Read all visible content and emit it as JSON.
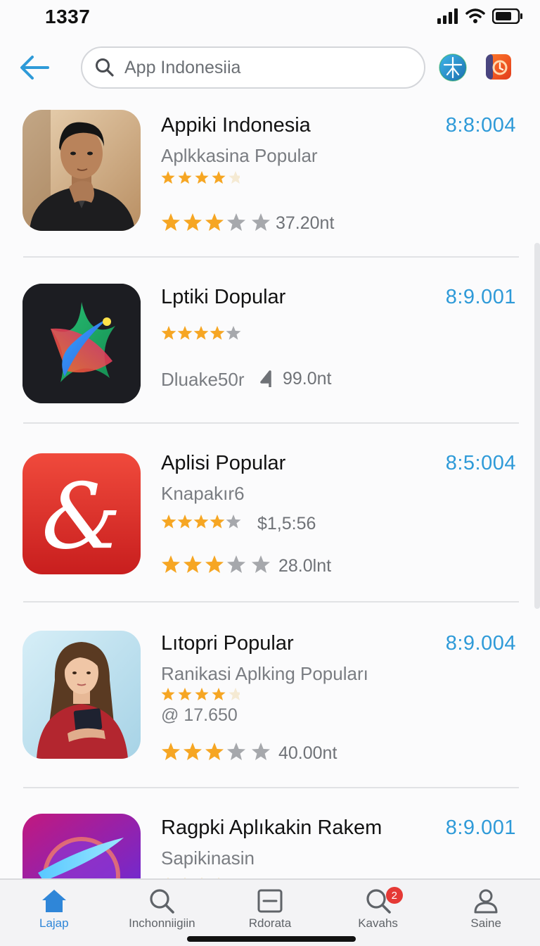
{
  "status_bar": {
    "time": "1337"
  },
  "header": {
    "search_placeholder": "App Indonesiia",
    "icons": [
      "back-arrow-icon",
      "search-icon",
      "globe-app-icon",
      "orange-app-icon"
    ]
  },
  "apps": [
    {
      "name": "Appiki Indonesia",
      "version": "8:8:004",
      "subtitle": "Aplkkasina Popular",
      "rating_text": "37.20nt",
      "thumb": "portrait-man",
      "colors": {
        "accent": "#f6a623"
      }
    },
    {
      "name": "Lptiki Dopular",
      "version": "8:9.001",
      "developer": "Dluake50r",
      "rating_text": "99.0nt",
      "thumb": "colorful-star-logo"
    },
    {
      "name": "Aplisi Popular",
      "version": "8:5:004",
      "subtitle": "Knapakır6",
      "price": "$1,5:56",
      "rating_text": "28.0lnt",
      "thumb": "red-ampersand-logo"
    },
    {
      "name": "Lıtopri Popular",
      "version": "8:9.004",
      "subtitle": "Ranikasi Aplking Popuları",
      "extra": "@ 17.650",
      "rating_text": "40.00nt",
      "thumb": "portrait-woman-tablet"
    },
    {
      "name": "Ragpki Aplıkakin Rakem",
      "version": "8:9.001",
      "subtitle": "Sapikinasin",
      "thumb": "purple-planet-logo"
    }
  ],
  "tabs": [
    {
      "label": "Lajap",
      "icon": "home-icon"
    },
    {
      "label": "Inchonniigiin",
      "icon": "search-icon"
    },
    {
      "label": "Rdorata",
      "icon": "list-box-icon"
    },
    {
      "label": "Kavahs",
      "icon": "search-badge-icon",
      "badge": "2"
    },
    {
      "label": "Saine",
      "icon": "person-icon"
    }
  ],
  "colors": {
    "accent": "#2e9ad8",
    "star": "#f6a623",
    "star_empty": "#a6a8ac",
    "tab_active": "#2f86d8"
  }
}
